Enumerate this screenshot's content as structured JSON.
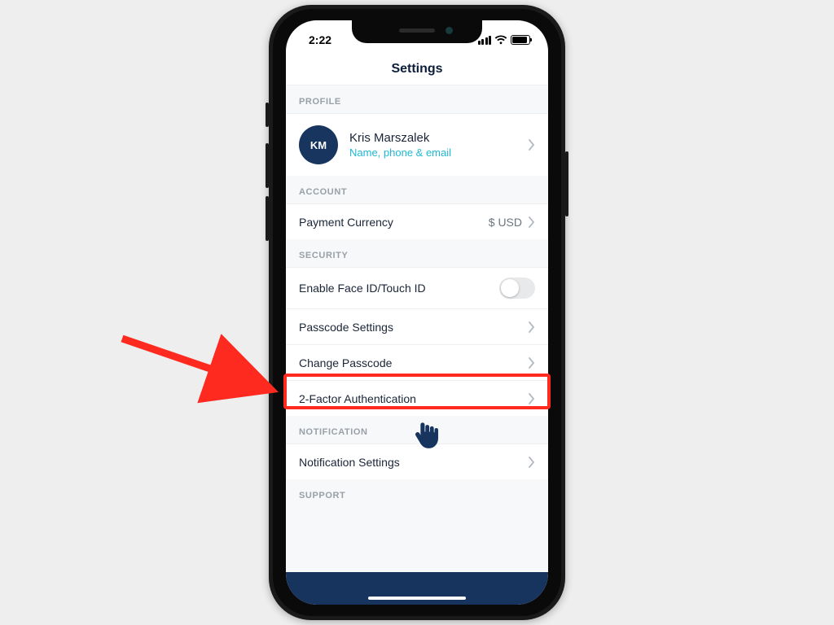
{
  "status": {
    "time": "2:22"
  },
  "header": {
    "title": "Settings"
  },
  "sections": {
    "profile": {
      "header": "PROFILE",
      "avatar_initials": "KM",
      "name": "Kris Marszalek",
      "subtitle": "Name, phone & email"
    },
    "account": {
      "header": "ACCOUNT",
      "payment_currency_label": "Payment Currency",
      "payment_currency_value": "$ USD"
    },
    "security": {
      "header": "SECURITY",
      "faceid_label": "Enable Face ID/Touch ID",
      "faceid_enabled": false,
      "passcode_settings": "Passcode Settings",
      "change_passcode": "Change Passcode",
      "two_factor": "2-Factor Authentication"
    },
    "notification": {
      "header": "NOTIFICATION",
      "settings": "Notification Settings"
    },
    "support": {
      "header": "SUPPORT"
    }
  },
  "annotation": {
    "highlighted_item": "2-Factor Authentication",
    "arrow_color": "#ff2a1f",
    "cursor_color": "#17345e"
  }
}
